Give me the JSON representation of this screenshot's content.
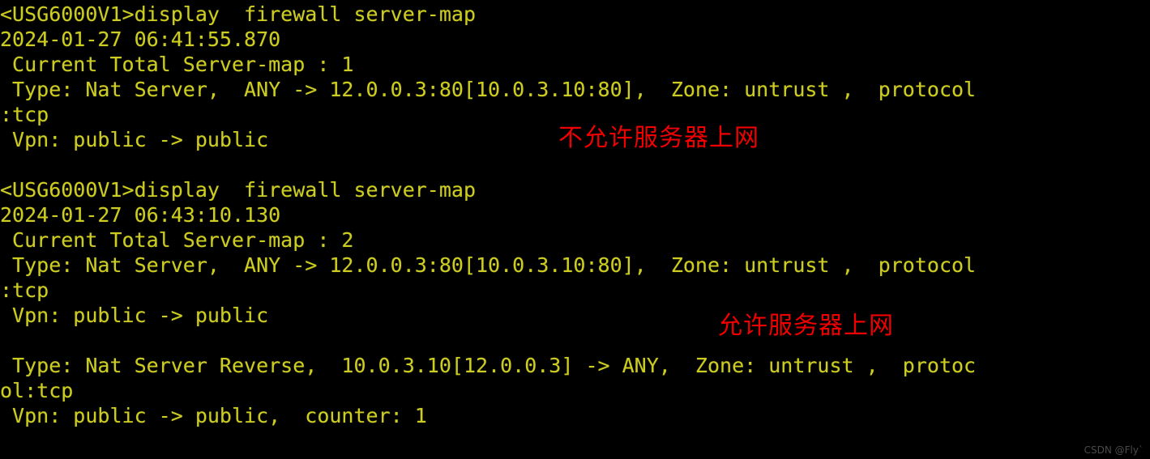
{
  "terminal": {
    "background_color": "#000000",
    "text_color": "#cccc22",
    "annotation_color": "#f00000",
    "lines": [
      "<USG6000V1>display  firewall server-map",
      "2024-01-27 06:41:55.870",
      " Current Total Server-map : 1",
      " Type: Nat Server,  ANY -> 12.0.0.3:80[10.0.3.10:80],  Zone: untrust ,  protocol",
      ":tcp",
      " Vpn: public -> public",
      "",
      "<USG6000V1>display  firewall server-map",
      "2024-01-27 06:43:10.130",
      " Current Total Server-map : 2",
      " Type: Nat Server,  ANY -> 12.0.0.3:80[10.0.3.10:80],  Zone: untrust ,  protocol",
      ":tcp",
      " Vpn: public -> public",
      "",
      " Type: Nat Server Reverse,  10.0.3.10[12.0.0.3] -> ANY,  Zone: untrust ,  protoc",
      "ol:tcp",
      " Vpn: public -> public,  counter: 1"
    ]
  },
  "annotations": {
    "deny_label": "不允许服务器上网",
    "allow_label": "允许服务器上网"
  },
  "watermark": {
    "text": "CSDN @Fly`"
  }
}
